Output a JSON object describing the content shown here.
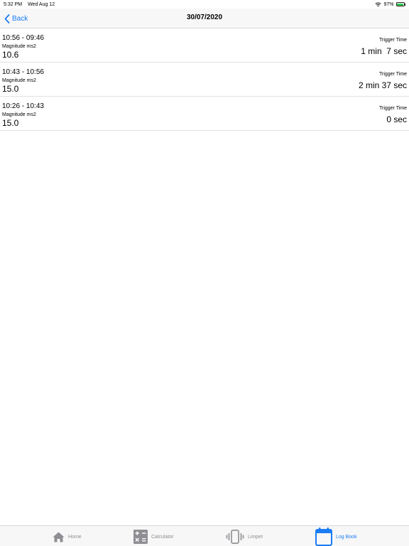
{
  "status_bar": {
    "time": "5:32 PM",
    "date": "Wed Aug 12",
    "battery": "97%",
    "battery_level": 0.97
  },
  "nav": {
    "back_label": "Back",
    "title": "30/07/2020"
  },
  "entries": [
    {
      "time_range": "10:56 - 09:46",
      "magnitude_label": "Magnitude ms2",
      "magnitude": "10.6",
      "trigger_label": "Trigger Time",
      "trigger_time": "1 min  7 sec"
    },
    {
      "time_range": "10:43 - 10:56",
      "magnitude_label": "Magnitude ms2",
      "magnitude": "15.0",
      "trigger_label": "Trigger Time",
      "trigger_time": "2 min 37 sec"
    },
    {
      "time_range": "10:26 - 10:43",
      "magnitude_label": "Magnitude ms2",
      "magnitude": "15.0",
      "trigger_label": "Trigger Time",
      "trigger_time": "0 sec"
    }
  ],
  "tabs": [
    {
      "label": "Home",
      "icon": "home-icon",
      "active": false
    },
    {
      "label": "Calculator",
      "icon": "calculator-icon",
      "active": false
    },
    {
      "label": "Limpet",
      "icon": "vibration-icon",
      "active": false
    },
    {
      "label": "Log Book",
      "icon": "calendar-icon",
      "active": true
    }
  ],
  "colors": {
    "accent": "#1a7cf5",
    "inactive": "#8e8e93",
    "battery": "#34c759"
  }
}
